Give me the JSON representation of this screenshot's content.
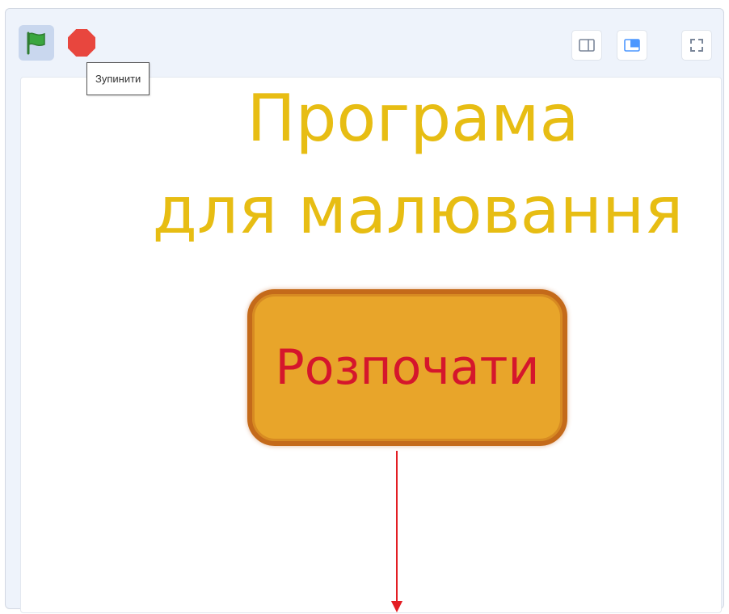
{
  "controls": {
    "green_flag_icon": "green-flag-icon",
    "stop_icon": "stop-icon",
    "stop_tooltip": "Зупинити",
    "small_stage_icon": "small-stage-icon",
    "normal_stage_icon": "normal-stage-icon",
    "fullscreen_icon": "fullscreen-icon"
  },
  "stage": {
    "title_line_1": "Програма",
    "title_line_2": "для малювання",
    "start_button_label": "Розпочати",
    "title_color": "#e6b800",
    "button_fill": "#e8a52a",
    "button_text_color": "#d5162c",
    "arrow_color": "#e31e24"
  }
}
